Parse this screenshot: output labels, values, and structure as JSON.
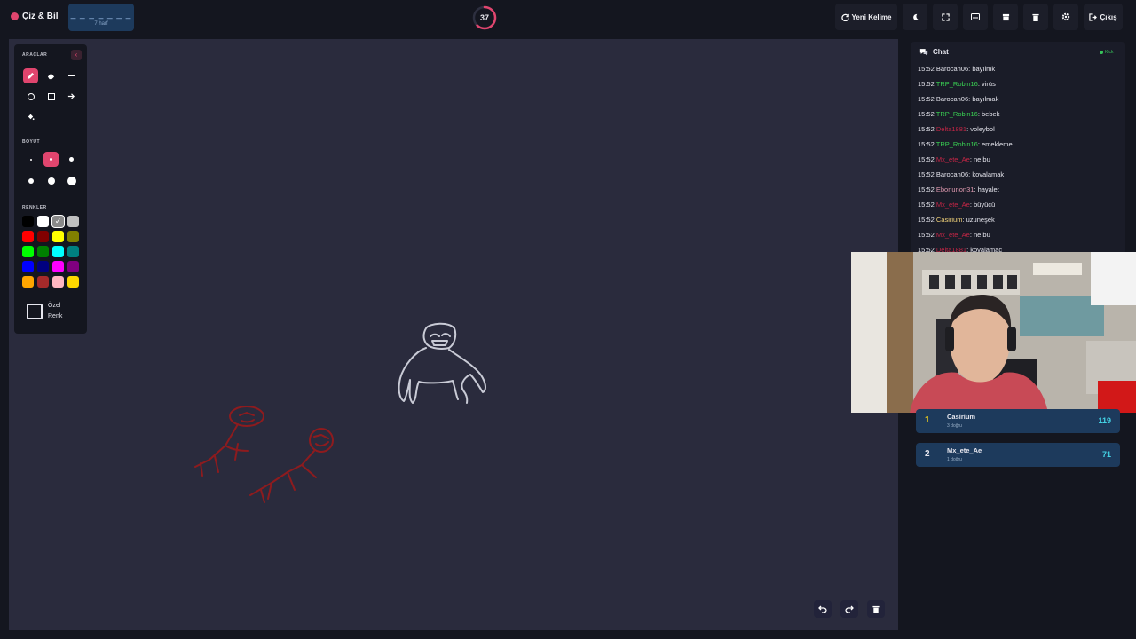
{
  "app": {
    "title": "Çiz & Bil"
  },
  "word": {
    "hint": "_ _ _ _ _ _ _",
    "length_label": "7 harf"
  },
  "timer": {
    "value": "37",
    "remaining_fraction": 0.62,
    "color": "#e0456e"
  },
  "toolbar": {
    "new_word_label": "Yeni Kelime",
    "exit_label": "Çıkış",
    "icons": [
      "refresh-icon",
      "moon-icon",
      "fullscreen-icon",
      "keyboard-icon",
      "archive-icon",
      "trash-icon",
      "gear-icon",
      "logout-icon"
    ]
  },
  "tools": {
    "section_tools": "ARAÇLAR",
    "section_size": "BOYUT",
    "section_colors": "RENKLER",
    "items": [
      "pencil",
      "eraser",
      "line",
      "circle",
      "rectangle",
      "arrow",
      "fill"
    ],
    "active_tool": "pencil",
    "active_size_index": 1,
    "active_color": "#8a8a8a",
    "custom_color_label_1": "Özel",
    "custom_color_label_2": "Renk",
    "colors": [
      "#000000",
      "#ffffff",
      "#8a8a8a",
      "#c0c0c0",
      "#ff0000",
      "#800000",
      "#ffff00",
      "#808000",
      "#00ff00",
      "#008000",
      "#00ffff",
      "#008080",
      "#0000ff",
      "#000080",
      "#ff00ff",
      "#800080",
      "#ffa500",
      "#a52a2a",
      "#ffb6c1",
      "#ffd700"
    ]
  },
  "chat": {
    "title": "Chat",
    "badge": "Kick",
    "messages": [
      {
        "time": "15:52",
        "user": "Barocan06",
        "color": "#e6e6ee",
        "text": "bayılmk"
      },
      {
        "time": "15:52",
        "user": "TRP_Robin16",
        "color": "#39d353",
        "text": "virüs"
      },
      {
        "time": "15:52",
        "user": "Barocan06",
        "color": "#e6e6ee",
        "text": "bayılmak"
      },
      {
        "time": "15:52",
        "user": "TRP_Robin16",
        "color": "#39d353",
        "text": "bebek"
      },
      {
        "time": "15:52",
        "user": "Delta1881",
        "color": "#c62646",
        "text": "voleybol"
      },
      {
        "time": "15:52",
        "user": "TRP_Robin16",
        "color": "#39d353",
        "text": "emekleme"
      },
      {
        "time": "15:52",
        "user": "Mx_ete_Ae",
        "color": "#c62646",
        "text": "ne bu"
      },
      {
        "time": "15:52",
        "user": "Barocan06",
        "color": "#e6e6ee",
        "text": "kovalamak"
      },
      {
        "time": "15:52",
        "user": "Ebonunon31",
        "color": "#e09ab0",
        "text": "hayalet"
      },
      {
        "time": "15:52",
        "user": "Mx_ete_Ae",
        "color": "#c62646",
        "text": "büyücü"
      },
      {
        "time": "15:52",
        "user": "Casirium",
        "color": "#f3d37a",
        "text": "uzuneşek"
      },
      {
        "time": "15:52",
        "user": "Mx_ete_Ae",
        "color": "#c62646",
        "text": "ne bu"
      },
      {
        "time": "15:52",
        "user": "Delta1881",
        "color": "#c62646",
        "text": "kovalamac"
      }
    ]
  },
  "leaderboard": [
    {
      "rank": "1",
      "name": "Casirium",
      "sub": "3 doğru",
      "points": "119",
      "rank_color": "#f3d21a"
    },
    {
      "rank": "2",
      "name": "Mx_ete_Ae",
      "sub": "1 doğru",
      "points": "71",
      "rank_color": "#e6e6ee"
    }
  ],
  "canvas_controls": {
    "icons": [
      "undo-icon",
      "redo-icon",
      "clear-canvas-icon"
    ]
  },
  "colors": {
    "accent": "#e0456e",
    "background": "#14161f",
    "canvas": "#2a2b3d",
    "panel": "#1a1c28",
    "leaderboard_row": "#1d3a5c"
  }
}
